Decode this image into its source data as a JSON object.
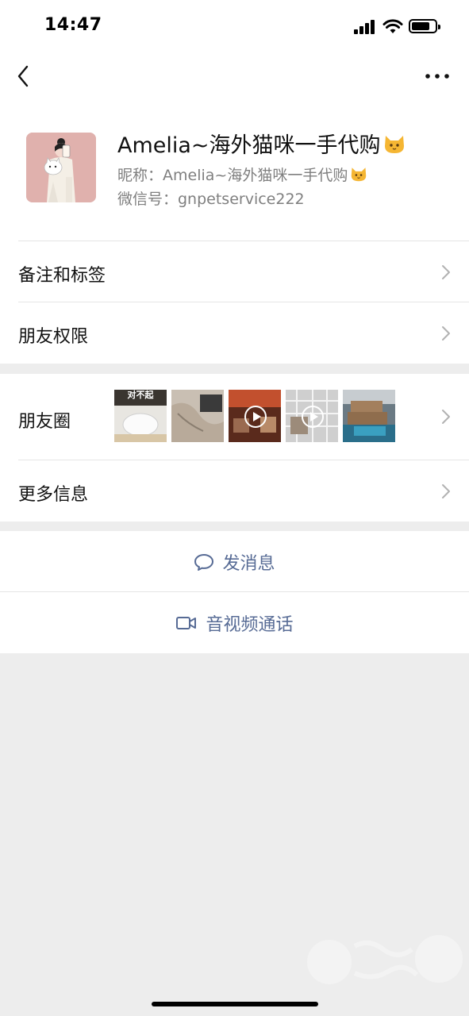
{
  "status_bar": {
    "time": "14:47"
  },
  "nav": {
    "back_icon": "chevron-left-icon",
    "more_icon": "ellipsis-icon"
  },
  "profile": {
    "name": "Amelia~海外猫咪一手代购",
    "nickname": "昵称：Amelia~海外猫咪一手代购",
    "wechat_id": "微信号：gnpetservice222",
    "emoji": "cat-face-emoji"
  },
  "rows": {
    "remarks_tags": "备注和标签",
    "friend_permissions": "朋友权限",
    "moments": "朋友圈",
    "more_info": "更多信息"
  },
  "moments": {
    "thumbs": [
      {
        "caption": "对不起",
        "video": false
      },
      {
        "caption": "",
        "video": false
      },
      {
        "caption": "",
        "video": true
      },
      {
        "caption": "",
        "video": true
      },
      {
        "caption": "",
        "video": false
      }
    ]
  },
  "actions": {
    "send_message": "发消息",
    "video_call": "音视频通话"
  },
  "colors": {
    "link_blue": "#576b95",
    "background": "#ededed",
    "chevron": "#b2b2b2"
  }
}
